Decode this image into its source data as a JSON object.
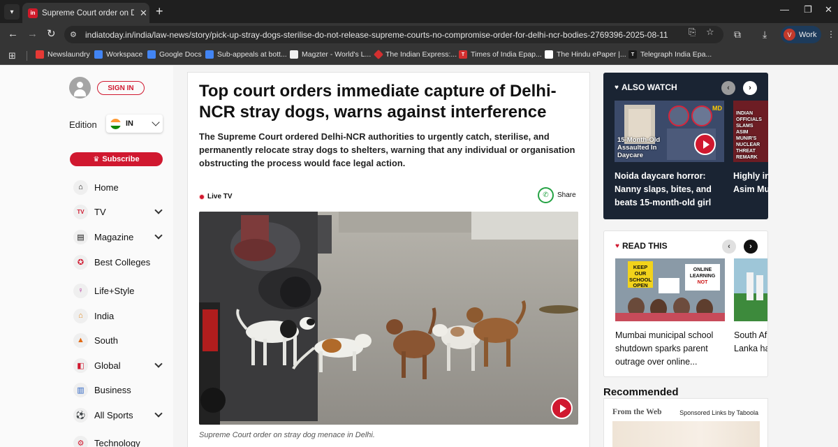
{
  "browser": {
    "tab_title": "Supreme Court order on Delhi stray dogs",
    "tab_favicon": "in",
    "url": "indiatoday.in/india/law-news/story/pick-up-stray-dogs-sterilise-do-not-release-supreme-courts-no-compromise-order-for-delhi-ncr-bodies-2769396-2025-08-11",
    "profile_initial": "V",
    "profile_label": "Work",
    "bookmarks": [
      {
        "label": "Newslaundry",
        "icon_color": "#e53935"
      },
      {
        "label": "Workspace",
        "icon_color": "#4285f4"
      },
      {
        "label": "Google Docs",
        "icon_color": "#4285f4"
      },
      {
        "label": "Sub-appeals at bott...",
        "icon_color": "#4285f4"
      },
      {
        "label": "Magzter - World's L...",
        "icon_color": "#f0f0f0"
      },
      {
        "label": "The Indian Express:...",
        "icon_color": "#d32f2f"
      },
      {
        "label": "Times of India Epap...",
        "icon_color": "#d32f2f"
      },
      {
        "label": "The Hindu ePaper |...",
        "icon_color": "#ffffff"
      },
      {
        "label": "Telegraph India Epa...",
        "icon_color": "#000000"
      }
    ]
  },
  "sidebar": {
    "signin_label": "SIGN IN",
    "edition_label": "Edition",
    "edition_value": "IN",
    "subscribe_label": "Subscribe",
    "items": [
      {
        "label": "Home",
        "icon": "home-icon",
        "chevron": false
      },
      {
        "label": "TV",
        "icon": "tv-icon",
        "chevron": true
      },
      {
        "label": "Magazine",
        "icon": "magazine-icon",
        "chevron": true
      },
      {
        "label": "Best Colleges",
        "icon": "college-icon",
        "chevron": false
      },
      {
        "label": "Life+Style",
        "icon": "lifestyle-icon",
        "chevron": false
      },
      {
        "label": "India",
        "icon": "india-icon",
        "chevron": false
      },
      {
        "label": "South",
        "icon": "south-icon",
        "chevron": false
      },
      {
        "label": "Global",
        "icon": "global-icon",
        "chevron": true
      },
      {
        "label": "Business",
        "icon": "business-icon",
        "chevron": false
      },
      {
        "label": "All Sports",
        "icon": "sports-icon",
        "chevron": true
      },
      {
        "label": "Technology",
        "icon": "technology-icon",
        "chevron": false
      }
    ]
  },
  "article": {
    "headline": "Top court orders immediate capture of Delhi-NCR stray dogs, warns against interference",
    "summary": "The Supreme Court ordered Delhi-NCR authorities to urgently catch, sterilise, and permanently relocate stray dogs to shelters, warning that any individual or organisation obstructing the process would face legal action.",
    "live_label": "Live TV",
    "share_label": "Share",
    "caption": "Supreme Court order on stray dog menace in Delhi."
  },
  "also_watch": {
    "title": "ALSO WATCH",
    "cards": [
      {
        "thumb_caption": "15-Month-Old Assaulted In Daycare",
        "title": "Noida daycare horror: Nanny slaps, bites, and beats 15-month-old girl"
      },
      {
        "thumb_caption": "INDIAN OFFICIALS SLAMS ASIM MUNIR'S NUCLEAR THREAT REMARK",
        "title": "Highly in... slams Pa... Asim Mu..."
      }
    ]
  },
  "read_this": {
    "title": "READ THIS",
    "cards": [
      {
        "title": "Mumbai municipal school shutdown sparks parent outrage over online..."
      },
      {
        "title": "South Af... reach WT... Lanka ha..."
      }
    ]
  },
  "recommended": {
    "title": "Recommended",
    "from_web": "From the Web",
    "sponsored": "Sponsored Links by Taboola"
  },
  "colors": {
    "brand_red": "#d0182f",
    "dark_panel": "#1a2433",
    "browser_chrome": "#353535"
  }
}
